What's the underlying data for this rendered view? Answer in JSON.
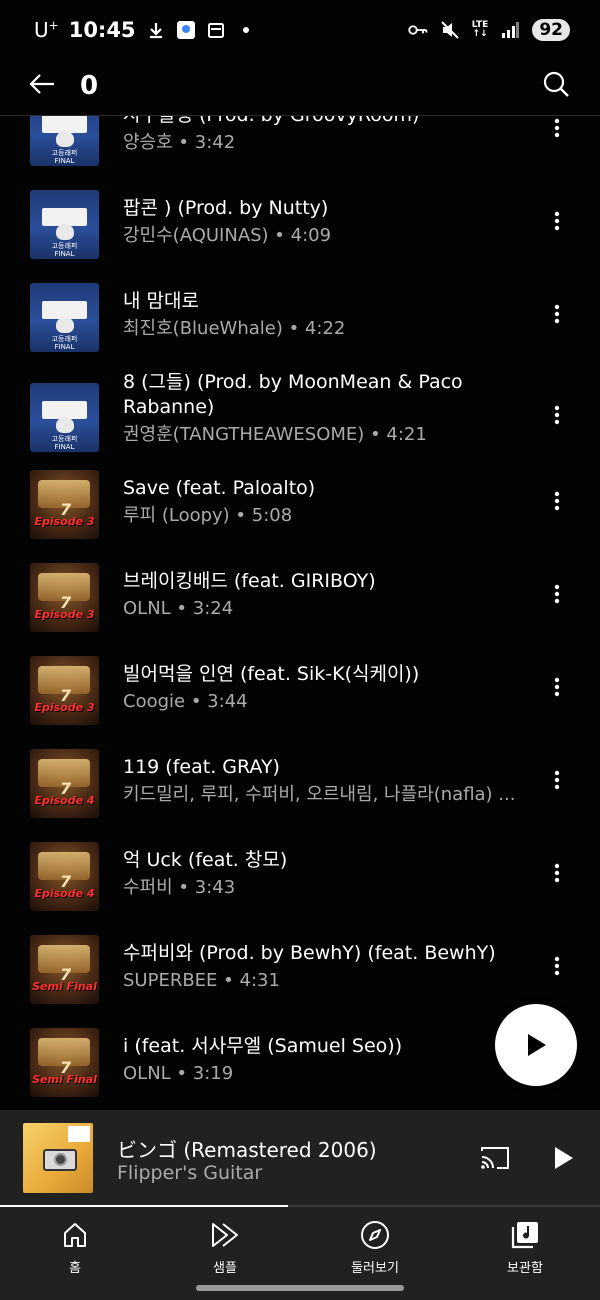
{
  "status_bar": {
    "carrier": "U",
    "carrier_sup": "+",
    "time": "10:45",
    "network": "LTE",
    "battery": "92"
  },
  "app_bar": {
    "title": "0"
  },
  "tracks": [
    {
      "title": "시꾸블링 (Prod. by GroovyRoom)",
      "subtitle": "양승호 • 3:42",
      "art": "hs",
      "art_label": "고등래퍼\nFINAL"
    },
    {
      "title": "팝콘 ) (Prod. by Nutty)",
      "subtitle": "강민수(AQUINAS) • 4:09",
      "art": "hs",
      "art_label": "고등래퍼\nFINAL"
    },
    {
      "title": "내 맘대로",
      "subtitle": "최진호(BlueWhale) • 4:22",
      "art": "hs",
      "art_label": "고등래퍼\nFINAL"
    },
    {
      "title": "8 (그들) (Prod. by MoonMean & Paco Rabanne)",
      "subtitle": "권영훈(TANGTHEAWESOME) • 4:21",
      "art": "hs",
      "art_label": "고등래퍼\nFINAL"
    },
    {
      "title": "Save (feat. Paloalto)",
      "subtitle": "루피 (Loopy) • 5:08",
      "art": "smtm",
      "art_label": "Episode 3"
    },
    {
      "title": "브레이킹배드 (feat. GIRIBOY)",
      "subtitle": "OLNL • 3:24",
      "art": "smtm",
      "art_label": "Episode 3"
    },
    {
      "title": "빌어먹을 인연 (feat. Sik-K(식케이))",
      "subtitle": "Coogie • 3:44",
      "art": "smtm",
      "art_label": "Episode 3"
    },
    {
      "title": "119 (feat. GRAY)",
      "subtitle": "키드밀리, 루피, 수퍼비, 오르내림, 나플라(nafla) ...",
      "art": "smtm",
      "art_label": "Episode 4"
    },
    {
      "title": "억 Uck (feat. 창모)",
      "subtitle": "수퍼비 • 3:43",
      "art": "smtm",
      "art_label": "Episode 4"
    },
    {
      "title": "수퍼비와 (Prod. by BewhY) (feat. BewhY)",
      "subtitle": "SUPERBEE • 4:31",
      "art": "smtm",
      "art_label": "Semi Final"
    },
    {
      "title": "i (feat. 서사무엘 (Samuel Seo))",
      "subtitle": "OLNL • 3:19",
      "art": "smtm",
      "art_label": "Semi Final"
    }
  ],
  "mini_player": {
    "title": "ビンゴ (Remastered 2006)",
    "artist": "Flipper's Guitar",
    "progress": 0.48
  },
  "bottom_nav": [
    {
      "label": "홈",
      "icon": "home-icon"
    },
    {
      "label": "샘플",
      "icon": "samples-icon"
    },
    {
      "label": "둘러보기",
      "icon": "explore-icon"
    },
    {
      "label": "보관함",
      "icon": "library-icon"
    }
  ],
  "colors": {
    "background": "#030303",
    "secondary_text": "#aaaaaa",
    "player_bg": "#212121"
  }
}
